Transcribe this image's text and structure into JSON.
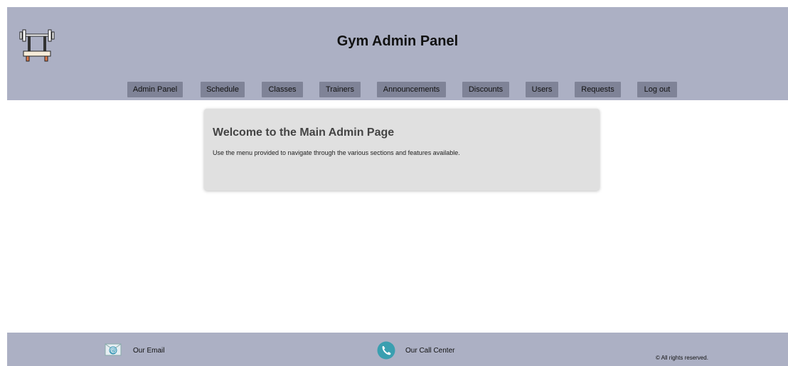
{
  "header": {
    "title": "Gym Admin Panel",
    "logo_icon": "barbell-bench-icon"
  },
  "nav": {
    "items": [
      {
        "label": "Admin Panel"
      },
      {
        "label": "Schedule"
      },
      {
        "label": "Classes"
      },
      {
        "label": "Trainers"
      },
      {
        "label": "Announcements"
      },
      {
        "label": "Discounts"
      },
      {
        "label": "Users"
      },
      {
        "label": "Requests"
      },
      {
        "label": "Log out"
      }
    ]
  },
  "main": {
    "heading": "Welcome to the Main Admin Page",
    "description": "Use the menu provided to navigate through the various sections and features available."
  },
  "footer": {
    "email_label": "Our Email",
    "email_icon": "email-icon",
    "call_label": "Our Call Center",
    "call_icon": "phone-icon",
    "copyright": "© All rights reserved."
  },
  "colors": {
    "header_bg": "#acb0c4",
    "nav_button_bg": "#7f8397",
    "card_bg": "#e0e0e0",
    "phone_icon_bg": "#3a9fb0"
  }
}
